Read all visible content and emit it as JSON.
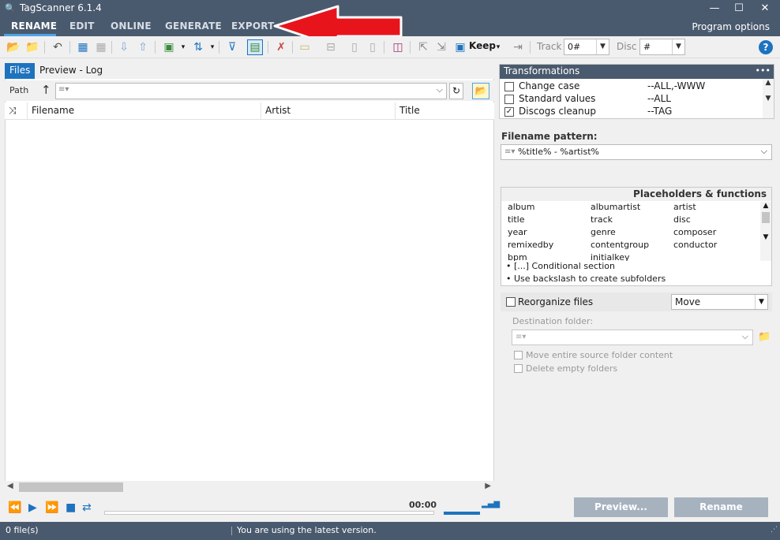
{
  "window": {
    "title": "TagScanner 6.1.4",
    "minimize": "—",
    "maximize": "☐",
    "close": "✕"
  },
  "menu": {
    "tabs": [
      "RENAME",
      "EDIT",
      "ONLINE",
      "GENERATE",
      "EXPORT"
    ],
    "active": "RENAME",
    "program_options": "Program options"
  },
  "toolbar": {
    "keep_label": "Keep",
    "track_label": "Track",
    "track_value": "0#",
    "disc_label": "Disc",
    "disc_value": "#",
    "help": "?"
  },
  "left": {
    "tabs": [
      "Files",
      "Preview - Log"
    ],
    "path_label": "Path",
    "path_placeholder_icon": "≡▾",
    "columns": [
      "Filename",
      "Artist",
      "Title"
    ]
  },
  "player": {
    "time": "00:00"
  },
  "transformations": {
    "title": "Transformations",
    "more": "•••",
    "rows": [
      {
        "name": "Change case",
        "target": "--ALL,-WWW",
        "checked": false
      },
      {
        "name": "Standard values",
        "target": "--ALL",
        "checked": false
      },
      {
        "name": "Discogs cleanup",
        "target": "--TAG",
        "checked": true
      }
    ]
  },
  "filename_pattern": {
    "label": "Filename pattern:",
    "value": "%title% - %artist%"
  },
  "placeholders": {
    "title": "Placeholders & functions",
    "items": [
      [
        "album",
        "albumartist",
        "artist"
      ],
      [
        "title",
        "track",
        "disc"
      ],
      [
        "year",
        "genre",
        "composer"
      ],
      [
        "remixedby",
        "contentgroup",
        "conductor"
      ],
      [
        "bpm",
        "initialkey",
        ""
      ]
    ],
    "notes": [
      "• [...] Conditional section",
      "• Use backslash to create subfolders"
    ]
  },
  "reorganize": {
    "label": "Reorganize files",
    "mode": "Move",
    "destination_label": "Destination folder:",
    "options": [
      "Move entire source folder content",
      "Delete empty folders"
    ]
  },
  "buttons": {
    "preview": "Preview...",
    "rename": "Rename"
  },
  "status": {
    "file_count": "0 file(s)",
    "message": "You are using the latest version."
  },
  "colors": {
    "chrome": "#4a5a6e",
    "accent": "#1e73be",
    "annotation": "#e8141c"
  }
}
